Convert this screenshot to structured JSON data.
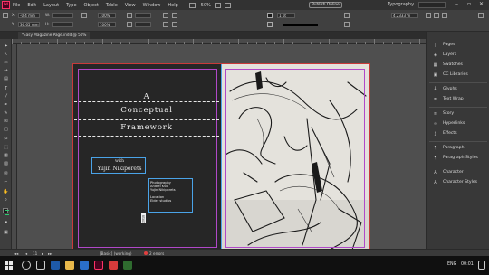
{
  "menubar": {
    "logo": "Id",
    "items": [
      "File",
      "Edit",
      "Layout",
      "Type",
      "Object",
      "Table",
      "View",
      "Window",
      "Help"
    ],
    "zoom": "50%",
    "publish_label": "Publish Online",
    "workspace": "Typography"
  },
  "control": {
    "x_label": "X:",
    "x_value": "-0.4 mm",
    "y_label": "Y:",
    "y_value": "36.65 mm",
    "w_label": "W:",
    "h_label": "H:",
    "stroke_weight": "1 pt",
    "percent_a": "100%",
    "percent_b": "100%",
    "width_value": "4.2333 m"
  },
  "document_tab": "*Easy Magazine Page.indd @ 50%",
  "page": {
    "title_lines": [
      "A",
      "Conceptual",
      "Framework"
    ],
    "with_label": "with",
    "author": "Yujin Nikiporets",
    "credits": [
      "Photography",
      "Andrei Kvo",
      "Yujin Nikiporets",
      "",
      "Location",
      "Elder studios"
    ],
    "vertical_label": "2018"
  },
  "panels": [
    {
      "label": "Pages",
      "icon": "pages-icon"
    },
    {
      "label": "Layers",
      "icon": "layers-icon"
    },
    {
      "label": "Swatches",
      "icon": "swatches-icon"
    },
    {
      "label": "CC Libraries",
      "icon": "cc-libraries-icon"
    },
    {
      "label": "Glyphs",
      "icon": "glyphs-icon"
    },
    {
      "label": "Text Wrap",
      "icon": "text-wrap-icon"
    },
    {
      "label": "Story",
      "icon": "story-icon"
    },
    {
      "label": "Hyperlinks",
      "icon": "hyperlinks-icon"
    },
    {
      "label": "Effects",
      "icon": "effects-icon"
    },
    {
      "label": "Paragraph",
      "icon": "paragraph-icon"
    },
    {
      "label": "Paragraph Styles",
      "icon": "paragraph-styles-icon"
    },
    {
      "label": "Character",
      "icon": "character-icon"
    },
    {
      "label": "Character Styles",
      "icon": "character-styles-icon"
    }
  ],
  "status": {
    "page_number": "11",
    "profile": "[Basic] (working)",
    "errors": "2 errors"
  },
  "taskbar": {
    "language": "ENG",
    "time": "00:01"
  },
  "colors": {
    "accent_pink": "#ff3366",
    "frame_blue": "#4aa3e8",
    "margin_purple": "#b048c8",
    "bleed_red": "#c83a3a"
  }
}
